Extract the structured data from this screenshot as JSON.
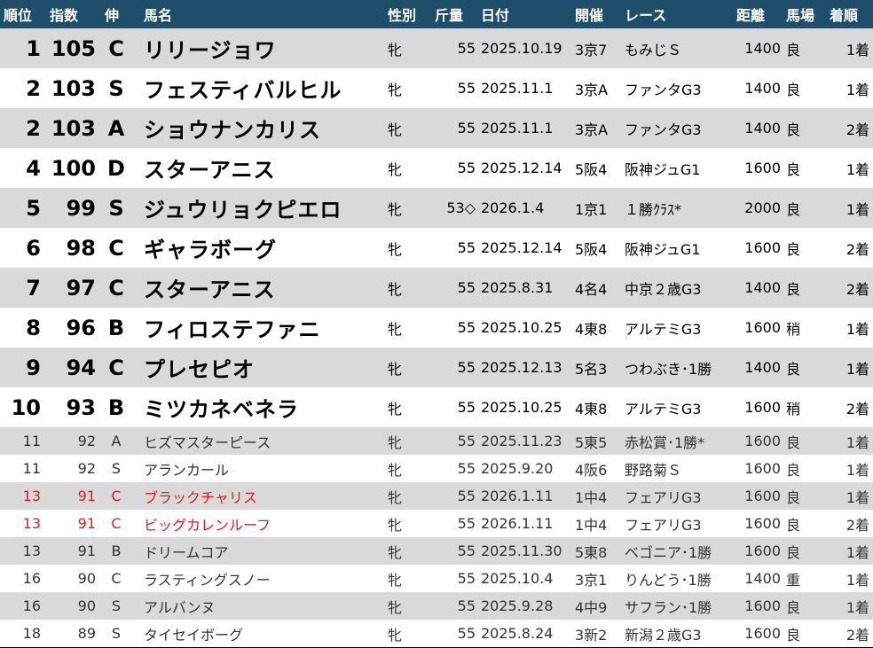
{
  "headers": {
    "rank": "順位",
    "index": "指数",
    "grade": "伸",
    "name": "馬名",
    "sex": "性別",
    "weight": "斤量",
    "date": "日付",
    "meeting": "開催",
    "race": "レース",
    "distance": "距離",
    "track": "馬場",
    "finish": "着順"
  },
  "rows": [
    {
      "rank": "1",
      "index": "105",
      "grade": "C",
      "name": "リリージョワ",
      "sex": "牝",
      "weight": "55",
      "date": "2025.10.19",
      "meeting": "3京7",
      "race": "もみじＳ",
      "distance": "1400",
      "track": "良",
      "finish": "1着"
    },
    {
      "rank": "2",
      "index": "103",
      "grade": "S",
      "name": "フェスティバルヒル",
      "sex": "牝",
      "weight": "55",
      "date": "2025.11.1",
      "meeting": "3京A",
      "race": "ファンタG3",
      "distance": "1400",
      "track": "良",
      "finish": "1着"
    },
    {
      "rank": "2",
      "index": "103",
      "grade": "A",
      "name": "ショウナンカリス",
      "sex": "牝",
      "weight": "55",
      "date": "2025.11.1",
      "meeting": "3京A",
      "race": "ファンタG3",
      "distance": "1400",
      "track": "良",
      "finish": "2着"
    },
    {
      "rank": "4",
      "index": "100",
      "grade": "D",
      "name": "スターアニス",
      "sex": "牝",
      "weight": "55",
      "date": "2025.12.14",
      "meeting": "5阪4",
      "race": "阪神ジュG1",
      "distance": "1600",
      "track": "良",
      "finish": "1着"
    },
    {
      "rank": "5",
      "index": "99",
      "grade": "S",
      "name": "ジュウリョクピエロ",
      "sex": "牝",
      "weight": "53◇",
      "date": "2026.1.4",
      "meeting": "1京1",
      "race": "１勝ｸﾗｽ*",
      "distance": "2000",
      "track": "良",
      "finish": "1着"
    },
    {
      "rank": "6",
      "index": "98",
      "grade": "C",
      "name": "ギャラボーグ",
      "sex": "牝",
      "weight": "55",
      "date": "2025.12.14",
      "meeting": "5阪4",
      "race": "阪神ジュG1",
      "distance": "1600",
      "track": "良",
      "finish": "2着"
    },
    {
      "rank": "7",
      "index": "97",
      "grade": "C",
      "name": "スターアニス",
      "sex": "牝",
      "weight": "55",
      "date": "2025.8.31",
      "meeting": "4名4",
      "race": "中京２歳G3",
      "distance": "1400",
      "track": "良",
      "finish": "2着"
    },
    {
      "rank": "8",
      "index": "96",
      "grade": "B",
      "name": "フィロステファニ",
      "sex": "牝",
      "weight": "55",
      "date": "2025.10.25",
      "meeting": "4東8",
      "race": "アルテミG3",
      "distance": "1600",
      "track": "稍",
      "finish": "1着"
    },
    {
      "rank": "9",
      "index": "94",
      "grade": "C",
      "name": "プレセピオ",
      "sex": "牝",
      "weight": "55",
      "date": "2025.12.13",
      "meeting": "5名3",
      "race": "つわぶき･1勝",
      "distance": "1400",
      "track": "良",
      "finish": "1着"
    },
    {
      "rank": "10",
      "index": "93",
      "grade": "B",
      "name": "ミツカネベネラ",
      "sex": "牝",
      "weight": "55",
      "date": "2025.10.25",
      "meeting": "4東8",
      "race": "アルテミG3",
      "distance": "1600",
      "track": "稍",
      "finish": "2着"
    },
    {
      "rank": "11",
      "index": "92",
      "grade": "A",
      "name": "ヒズマスターピース",
      "sex": "牝",
      "weight": "55",
      "date": "2025.11.23",
      "meeting": "5東5",
      "race": "赤松賞･1勝*",
      "distance": "1600",
      "track": "良",
      "finish": "1着"
    },
    {
      "rank": "11",
      "index": "92",
      "grade": "S",
      "name": "アランカール",
      "sex": "牝",
      "weight": "55",
      "date": "2025.9.20",
      "meeting": "4阪6",
      "race": "野路菊Ｓ",
      "distance": "1600",
      "track": "良",
      "finish": "1着"
    },
    {
      "rank": "13",
      "index": "91",
      "grade": "C",
      "name": "ブラックチャリス",
      "sex": "牝",
      "weight": "55",
      "date": "2026.1.11",
      "meeting": "1中4",
      "race": "フェアリG3",
      "distance": "1600",
      "track": "良",
      "finish": "1着"
    },
    {
      "rank": "13",
      "index": "91",
      "grade": "C",
      "name": "ビッグカレンルーフ",
      "sex": "牝",
      "weight": "55",
      "date": "2026.1.11",
      "meeting": "1中4",
      "race": "フェアリG3",
      "distance": "1600",
      "track": "良",
      "finish": "2着"
    },
    {
      "rank": "13",
      "index": "91",
      "grade": "B",
      "name": "ドリームコア",
      "sex": "牝",
      "weight": "55",
      "date": "2025.11.30",
      "meeting": "5東8",
      "race": "ベゴニア･1勝",
      "distance": "1600",
      "track": "良",
      "finish": "1着"
    },
    {
      "rank": "16",
      "index": "90",
      "grade": "C",
      "name": "ラスティングスノー",
      "sex": "牝",
      "weight": "55",
      "date": "2025.10.4",
      "meeting": "3京1",
      "race": "りんどう･1勝",
      "distance": "1400",
      "track": "重",
      "finish": "1着"
    },
    {
      "rank": "16",
      "index": "90",
      "grade": "S",
      "name": "アルバンヌ",
      "sex": "牝",
      "weight": "55",
      "date": "2025.9.28",
      "meeting": "4中9",
      "race": "サフラン･1勝",
      "distance": "1600",
      "track": "良",
      "finish": "1着"
    },
    {
      "rank": "18",
      "index": "89",
      "grade": "S",
      "name": "タイセイボーグ",
      "sex": "牝",
      "weight": "55",
      "date": "2025.8.24",
      "meeting": "3新2",
      "race": "新潟２歳G3",
      "distance": "1600",
      "track": "良",
      "finish": "2着"
    }
  ],
  "highlight_color": "#e02020",
  "header_color": "#1f4e6b"
}
